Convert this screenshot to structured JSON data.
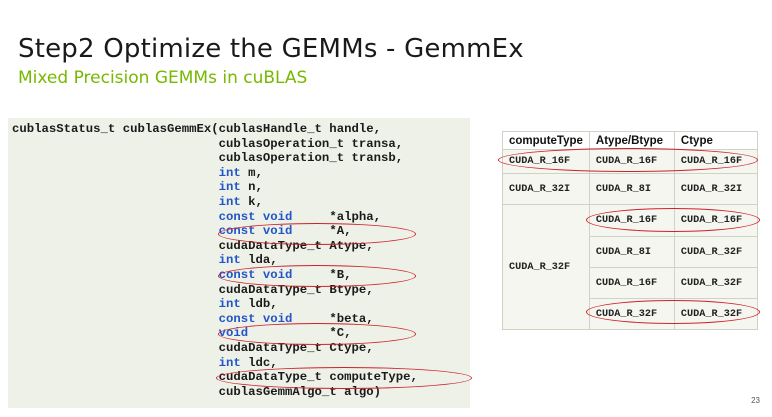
{
  "slide": {
    "title": "Step2 Optimize the GEMMs - GemmEx",
    "subtitle": "Mixed Precision GEMMs in cuBLAS",
    "page_number": "23"
  },
  "code": {
    "lines": [
      {
        "indent": "",
        "tokens": [
          {
            "t": "cublasStatus_t cublasGemmEx(cublasHandle_t handle,",
            "k": false
          }
        ]
      },
      {
        "indent": "                            ",
        "tokens": [
          {
            "t": "cublasOperation_t transa,",
            "k": false
          }
        ]
      },
      {
        "indent": "                            ",
        "tokens": [
          {
            "t": "cublasOperation_t transb,",
            "k": false
          }
        ]
      },
      {
        "indent": "                            ",
        "tokens": [
          {
            "t": "int",
            "k": true
          },
          {
            "t": " m,",
            "k": false
          }
        ]
      },
      {
        "indent": "                            ",
        "tokens": [
          {
            "t": "int",
            "k": true
          },
          {
            "t": " n,",
            "k": false
          }
        ]
      },
      {
        "indent": "                            ",
        "tokens": [
          {
            "t": "int",
            "k": true
          },
          {
            "t": " k,",
            "k": false
          }
        ]
      },
      {
        "indent": "                            ",
        "tokens": [
          {
            "t": "const void",
            "k": true
          },
          {
            "t": "     *alpha,",
            "k": false
          }
        ]
      },
      {
        "indent": "                            ",
        "tokens": [
          {
            "t": "const void",
            "k": true
          },
          {
            "t": "     *A,",
            "k": false
          }
        ]
      },
      {
        "indent": "                            ",
        "tokens": [
          {
            "t": "cudaDataType_t Atype,",
            "k": false
          }
        ]
      },
      {
        "indent": "                            ",
        "tokens": [
          {
            "t": "int",
            "k": true
          },
          {
            "t": " lda,",
            "k": false
          }
        ]
      },
      {
        "indent": "                            ",
        "tokens": [
          {
            "t": "const void",
            "k": true
          },
          {
            "t": "     *B,",
            "k": false
          }
        ]
      },
      {
        "indent": "                            ",
        "tokens": [
          {
            "t": "cudaDataType_t Btype,",
            "k": false
          }
        ]
      },
      {
        "indent": "                            ",
        "tokens": [
          {
            "t": "int",
            "k": true
          },
          {
            "t": " ldb,",
            "k": false
          }
        ]
      },
      {
        "indent": "                            ",
        "tokens": [
          {
            "t": "const void",
            "k": true
          },
          {
            "t": "     *beta,",
            "k": false
          }
        ]
      },
      {
        "indent": "                            ",
        "tokens": [
          {
            "t": "void",
            "k": true
          },
          {
            "t": "           *C,",
            "k": false
          }
        ]
      },
      {
        "indent": "                            ",
        "tokens": [
          {
            "t": "cudaDataType_t Ctype,",
            "k": false
          }
        ]
      },
      {
        "indent": "                            ",
        "tokens": [
          {
            "t": "int",
            "k": true
          },
          {
            "t": " ldc,",
            "k": false
          }
        ]
      },
      {
        "indent": "                            ",
        "tokens": [
          {
            "t": "cudaDataType_t computeType,",
            "k": false
          }
        ]
      },
      {
        "indent": "                            ",
        "tokens": [
          {
            "t": "cublasGemmAlgo_t algo)",
            "k": false
          }
        ]
      }
    ]
  },
  "table": {
    "headers": [
      "computeType",
      "Atype/Btype",
      "Ctype"
    ],
    "compute_types": [
      "CUDA_R_16F",
      "CUDA_R_32I",
      "CUDA_R_32F"
    ],
    "rows": [
      {
        "ab": "CUDA_R_16F",
        "c": "CUDA_R_16F"
      },
      {
        "ab": "CUDA_R_8I",
        "c": "CUDA_R_32I"
      },
      {
        "ab": "CUDA_R_16F",
        "c": "CUDA_R_16F"
      },
      {
        "ab": "CUDA_R_8I",
        "c": "CUDA_R_32F"
      },
      {
        "ab": "CUDA_R_16F",
        "c": "CUDA_R_32F"
      },
      {
        "ab": "CUDA_R_32F",
        "c": "CUDA_R_32F"
      }
    ]
  },
  "colors": {
    "accent_green": "#76b900",
    "keyword_blue": "#2255c8",
    "highlight_red": "#d0202a",
    "code_background": "#eef1e7"
  }
}
